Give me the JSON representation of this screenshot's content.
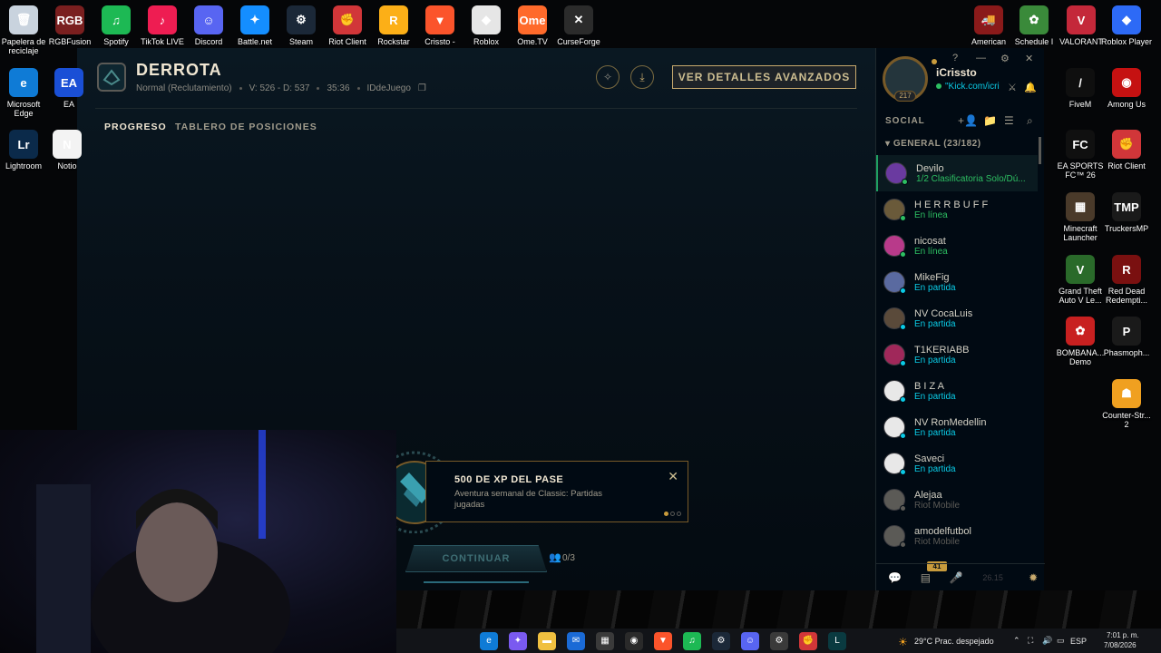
{
  "desktop_left": [
    {
      "label": "Papelera de reciclaje",
      "icon": "recycle-bin-icon",
      "color": "#c9d3de",
      "glyph": "🗑"
    },
    {
      "label": "RGBFusion",
      "icon": "rgbfusion-icon",
      "color": "#7a1f1f",
      "glyph": "RGB"
    },
    {
      "label": "Spotify",
      "icon": "spotify-icon",
      "color": "#1db954",
      "glyph": "♫"
    },
    {
      "label": "TikTok LIVE",
      "icon": "tiktok-icon",
      "color": "#ee1d52",
      "glyph": "♪"
    },
    {
      "label": "Discord",
      "icon": "discord-icon",
      "color": "#5865f2",
      "glyph": "☺"
    },
    {
      "label": "Battle.net",
      "icon": "battlenet-icon",
      "color": "#148eff",
      "glyph": "✦"
    },
    {
      "label": "Steam",
      "icon": "steam-icon",
      "color": "#1b2838",
      "glyph": "⚙"
    },
    {
      "label": "Riot Client",
      "icon": "riot-client-icon",
      "color": "#d13639",
      "glyph": "✊"
    },
    {
      "label": "Rockstar",
      "icon": "rockstar-icon",
      "color": "#fcaf17",
      "glyph": "R"
    },
    {
      "label": "Crissto -",
      "icon": "brave-icon",
      "color": "#fb542b",
      "glyph": "▼"
    },
    {
      "label": "Roblox",
      "icon": "roblox-icon",
      "color": "#e6e6e6",
      "glyph": "◆"
    },
    {
      "label": "Ome.TV",
      "icon": "ometv-icon",
      "color": "#ff6a2b",
      "glyph": "Ome"
    },
    {
      "label": "CurseForge",
      "icon": "curseforge-icon",
      "color": "#2b2b2b",
      "glyph": "✕"
    }
  ],
  "desktop_left_col": [
    {
      "label": "Microsoft Edge",
      "icon": "edge-icon",
      "color": "#0f7bd6",
      "glyph": "e"
    },
    {
      "label": "EA",
      "icon": "ea-icon",
      "color": "#1a4fd6",
      "glyph": "EA"
    },
    {
      "label": "Lightroom",
      "icon": "lightroom-icon",
      "color": "#0b2a4a",
      "glyph": "Lr"
    },
    {
      "label": "Notio",
      "icon": "notion-icon",
      "color": "#f3f3f3",
      "glyph": "N"
    }
  ],
  "desktop_right": [
    {
      "label": "American",
      "icon": "american-truck-icon",
      "color": "#8a1a1a",
      "glyph": "🚚"
    },
    {
      "label": "Schedule I",
      "icon": "schedule-icon",
      "color": "#3a8a3a",
      "glyph": "✿"
    },
    {
      "label": "VALORANT",
      "icon": "valorant-icon",
      "color": "#c4283a",
      "glyph": "V"
    },
    {
      "label": "Roblox Player",
      "icon": "roblox-player-icon",
      "color": "#2d6af6",
      "glyph": "◆"
    },
    {
      "label": "FiveM",
      "icon": "fivem-icon",
      "color": "#0f0f0f",
      "glyph": "/"
    },
    {
      "label": "Among Us",
      "icon": "among-us-icon",
      "color": "#c51111",
      "glyph": "◉"
    },
    {
      "label": "EA SPORTS FC™ 26",
      "icon": "fc26-icon",
      "color": "#101010",
      "glyph": "FC"
    },
    {
      "label": "Riot Client",
      "icon": "riot-client-2-icon",
      "color": "#d13639",
      "glyph": "✊"
    },
    {
      "label": "Minecraft Launcher",
      "icon": "minecraft-icon",
      "color": "#4a3a2a",
      "glyph": "▦"
    },
    {
      "label": "TruckersMP",
      "icon": "truckersmp-icon",
      "color": "#1a1a1a",
      "glyph": "TMP"
    },
    {
      "label": "Grand Theft Auto V Le...",
      "icon": "gta-icon",
      "color": "#2a6a2a",
      "glyph": "V"
    },
    {
      "label": "Red Dead Redempti...",
      "icon": "rdr-icon",
      "color": "#7a1010",
      "glyph": "R"
    },
    {
      "label": "BOMBANA... Demo",
      "icon": "bombana-icon",
      "color": "#c82020",
      "glyph": "✿"
    },
    {
      "label": "Phasmoph...",
      "icon": "phasmophobia-icon",
      "color": "#1a1a1a",
      "glyph": "P"
    },
    {
      "label": "Counter-Str... 2",
      "icon": "cs2-icon",
      "color": "#f0a020",
      "glyph": "☗"
    }
  ],
  "game": {
    "title": "DERROTA",
    "mode": "Normal (Reclutamiento)",
    "record": "V: 526 - D: 537",
    "duration": "35:36",
    "game_id": "IDdeJuego",
    "advanced_button": "VER DETALLES AVANZADOS",
    "tabs": [
      "PROGRESO",
      "TABLERO DE POSICIONES"
    ]
  },
  "summoner": {
    "name": "iCrissto",
    "status": "\"Kick.com/icri",
    "level": "217"
  },
  "social": {
    "label": "SOCIAL",
    "group": "GENERAL (23/182)",
    "friends": [
      {
        "name": "Devilo",
        "status": "1/2 Clasificatoria Solo/Dú...",
        "color": "#2dbf62",
        "avatar": "#6a3aa0",
        "selected": true
      },
      {
        "name": "H E R R B U F F",
        "status": "En línea",
        "color": "#2dbf62",
        "avatar": "#6a5a3a"
      },
      {
        "name": "nicosat",
        "status": "En línea",
        "color": "#2dbf62",
        "avatar": "#b83a8a"
      },
      {
        "name": "MikeFig",
        "status": "En partida",
        "color": "#0acbe6",
        "avatar": "#5a6aa0"
      },
      {
        "name": "NV CocaLuis",
        "status": "En partida",
        "color": "#0acbe6",
        "avatar": "#5a4a3a"
      },
      {
        "name": "T1KERIABB",
        "status": "En partida",
        "color": "#0acbe6",
        "avatar": "#a0285a"
      },
      {
        "name": "B I Z A",
        "status": "En partida",
        "color": "#0acbe6",
        "avatar": "#e8e8e8"
      },
      {
        "name": "NV RonMedellin",
        "status": "En partida",
        "color": "#0acbe6",
        "avatar": "#e8e8e8"
      },
      {
        "name": "Saveci",
        "status": "En partida",
        "color": "#0acbe6",
        "avatar": "#e8e8e8"
      },
      {
        "name": "Alejaa",
        "status": "Riot Mobile",
        "color": "#5b5a56",
        "avatar": "#5b5a56"
      },
      {
        "name": "amodelfutbol",
        "status": "Riot Mobile",
        "color": "#5b5a56",
        "avatar": "#5b5a56"
      }
    ],
    "badge": "41",
    "version": "26.15"
  },
  "notification": {
    "title": "500 DE XP DEL PASE",
    "description": "Aventura semanal de Classic: Partidas jugadas",
    "close": "✕"
  },
  "continue": {
    "label": "CONTINUAR",
    "count": "0/3"
  },
  "taskbar": {
    "weather": "29°C  Prac. despejado",
    "lang": "ESP",
    "time": "7:01 p. m.",
    "date": "7/08/2026"
  },
  "colors": {
    "gold": "#c8aa6e",
    "online": "#2dbf62",
    "ingame": "#0acbe6",
    "mobile": "#5b5a56"
  }
}
